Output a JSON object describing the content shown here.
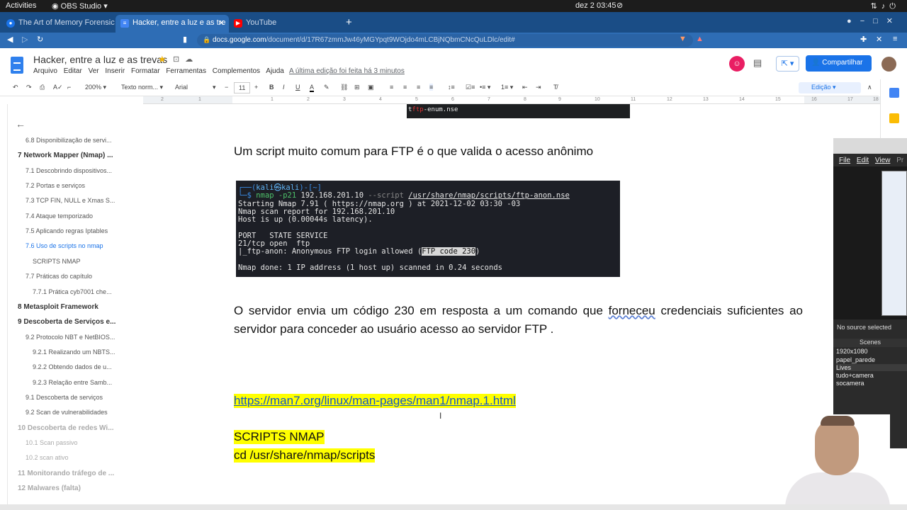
{
  "desktop": {
    "activities": "Activities",
    "app_name": "OBS Studio",
    "clock": "dez 2  03:45"
  },
  "browser": {
    "tabs": [
      {
        "label": "The Art of Memory Forensics",
        "color": "#1a73e8"
      },
      {
        "label": "Hacker, entre a luz e as tre",
        "color": "#4285f4"
      },
      {
        "label": "YouTube",
        "color": "#ff0000"
      }
    ],
    "url_domain": "docs.google.com",
    "url_path": "/document/d/17R67zmmJw46yMGYpqt9WOjdo4mLCBjNQbmCNcQuLDlc/edit#"
  },
  "doc": {
    "title": "Hacker, entre a luz e as trevas",
    "menu": [
      "Arquivo",
      "Editar",
      "Ver",
      "Inserir",
      "Formatar",
      "Ferramentas",
      "Complementos",
      "Ajuda"
    ],
    "last_edit": "A última edição foi feita há 3 minutos",
    "share_label": "Compartilhar",
    "mode_label": "Edição"
  },
  "toolbar": {
    "zoom": "200%",
    "style": "Texto norm...",
    "font": "Arial",
    "size": "11"
  },
  "ruler": [
    "2",
    "1",
    "1",
    "2",
    "3",
    "4",
    "5",
    "6",
    "7",
    "8",
    "9",
    "10",
    "11",
    "12",
    "13",
    "14",
    "15",
    "16",
    "17",
    "18"
  ],
  "outline": [
    {
      "label": "6.8 Disponibilização de servi...",
      "level": 2,
      "state": "normal"
    },
    {
      "label": "7 Network Mapper (Nmap) ...",
      "level": 1,
      "state": "normal"
    },
    {
      "label": "7.1 Descobrindo dispositivos...",
      "level": 2,
      "state": "normal"
    },
    {
      "label": "7.2 Portas e serviços",
      "level": 2,
      "state": "normal"
    },
    {
      "label": "7.3 TCP FIN, NULL e Xmas S...",
      "level": 2,
      "state": "normal"
    },
    {
      "label": "7.4 Ataque temporizado",
      "level": 2,
      "state": "normal"
    },
    {
      "label": "7.5 Aplicando regras Iptables",
      "level": 2,
      "state": "normal"
    },
    {
      "label": "7.6 Uso de scripts no nmap",
      "level": 2,
      "state": "current"
    },
    {
      "label": "SCRIPTS NMAP",
      "level": 3,
      "state": "normal"
    },
    {
      "label": "7.7 Práticas do capítulo",
      "level": 2,
      "state": "normal"
    },
    {
      "label": "7.7.1 Prática cyb7001 che...",
      "level": 3,
      "state": "normal"
    },
    {
      "label": "8 Metasploit Framework",
      "level": 1,
      "state": "normal"
    },
    {
      "label": "9 Descoberta de Serviços e...",
      "level": 1,
      "state": "normal"
    },
    {
      "label": "9.2 Protocolo NBT e NetBIOS...",
      "level": 2,
      "state": "normal"
    },
    {
      "label": "9.2.1 Realizando um NBTS...",
      "level": 3,
      "state": "normal"
    },
    {
      "label": "9.2.2 Obtendo dados de u...",
      "level": 3,
      "state": "normal"
    },
    {
      "label": "9.2.3 Relação entre Samb...",
      "level": 3,
      "state": "normal"
    },
    {
      "label": "9.1 Descoberta de serviços",
      "level": 2,
      "state": "normal"
    },
    {
      "label": "9.2 Scan de vulnerabilidades",
      "level": 2,
      "state": "normal"
    },
    {
      "label": "10 Descoberta de redes Wi...",
      "level": 1,
      "state": "dim"
    },
    {
      "label": "10.1 Scan passivo",
      "level": 2,
      "state": "dim"
    },
    {
      "label": "10.2 scan ativo",
      "level": 2,
      "state": "dim"
    },
    {
      "label": "11 Monitorando tráfego de ...",
      "level": 1,
      "state": "dim"
    },
    {
      "label": "12 Malwares (falta)",
      "level": 1,
      "state": "dim"
    }
  ],
  "content": {
    "term_top_a": "t",
    "term_top_red": "ftp",
    "term_top_b": "-enum.nse",
    "p1": "Um script muito comum para FTP é o que valida o acesso anônimo",
    "terminal": {
      "l1_a": "┌──(",
      "l1_user": "kali㉿kali",
      "l1_b": ")-[~]",
      "l2_a": "└─$ ",
      "l2_cmd": "nmap -p21",
      "l2_ip": " 192.168.201.10 ",
      "l2_opt": "--script ",
      "l2_path": "/usr/share/nmap/scripts/ftp-anon.nse",
      "l3": "Starting Nmap 7.91 ( https://nmap.org ) at 2021-12-02 03:30 -03",
      "l4": "Nmap scan report for 192.168.201.10",
      "l5": "Host is up (0.00044s latency).",
      "l6": "PORT   STATE SERVICE",
      "l7": "21/tcp open  ftp",
      "l8_a": "|_ftp-anon: Anonymous FTP login allowed (",
      "l8_hl": "FTP code 230",
      "l8_b": ")",
      "l9": "Nmap done: 1 IP address (1 host up) scanned in 0.24 seconds"
    },
    "p2_a": "O servidor envia um código 230 em resposta a um comando que ",
    "p2_sq": "forneceu",
    "p2_b": " credenciais suficientes ao servidor para conceder ao usuário acesso ao servidor FTP .",
    "link": "https://man7.org/linux/man-pages/man1/nmap.1.html",
    "scripts_title": "SCRIPTS NMAP",
    "scripts_cmd": "cd /usr/share/nmap/scripts"
  },
  "obs": {
    "menu": [
      "File",
      "Edit",
      "View",
      "Pr"
    ],
    "no_source": "No source selected",
    "scenes_header": "Scenes",
    "scenes": [
      "1920x1080",
      "papel_parede",
      "Lives",
      "tudo+camera",
      "socamera"
    ],
    "selected_scene": "Lives"
  }
}
